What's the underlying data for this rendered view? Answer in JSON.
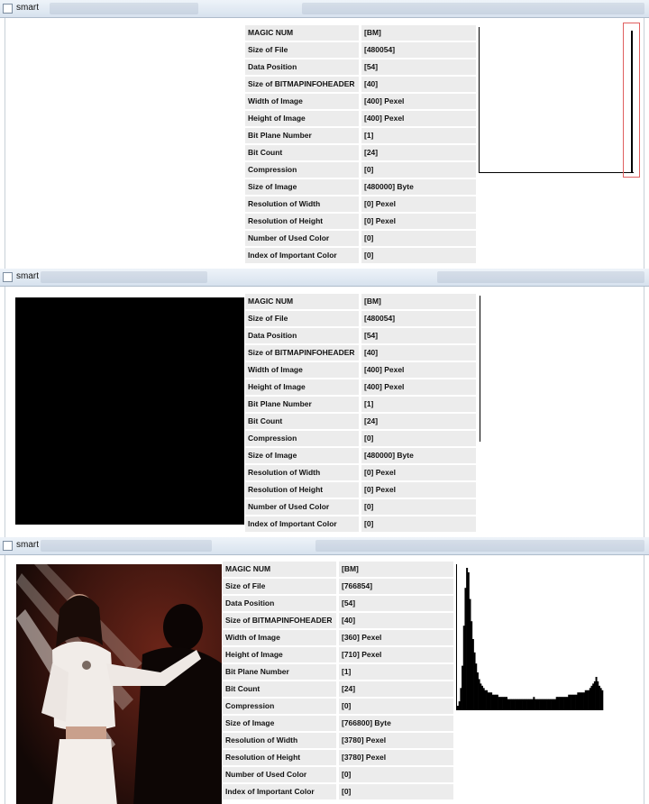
{
  "windows": [
    {
      "title": "smart",
      "info_rows": [
        {
          "label": "MAGIC NUM",
          "value": "[BM]"
        },
        {
          "label": "Size of File",
          "value": "[480054]"
        },
        {
          "label": "Data Position",
          "value": "[54]"
        },
        {
          "label": "Size of BITMAPINFOHEADER",
          "value": "[40]"
        },
        {
          "label": "Width of Image",
          "value": "[400] Pexel"
        },
        {
          "label": "Height of Image",
          "value": "[400] Pexel"
        },
        {
          "label": "Bit Plane Number",
          "value": "[1]"
        },
        {
          "label": "Bit Count",
          "value": "[24]"
        },
        {
          "label": "Compression",
          "value": "[0]"
        },
        {
          "label": "Size of Image",
          "value": "[480000] Byte"
        },
        {
          "label": "Resolution of Width",
          "value": "[0] Pexel"
        },
        {
          "label": "Resolution of Height",
          "value": "[0] Pexel"
        },
        {
          "label": "Number of Used Color",
          "value": "[0]"
        },
        {
          "label": "Index of Important Color",
          "value": "[0]"
        }
      ]
    },
    {
      "title": "smart",
      "info_rows": [
        {
          "label": "MAGIC NUM",
          "value": "[BM]"
        },
        {
          "label": "Size of File",
          "value": "[480054]"
        },
        {
          "label": "Data Position",
          "value": "[54]"
        },
        {
          "label": "Size of BITMAPINFOHEADER",
          "value": "[40]"
        },
        {
          "label": "Width of Image",
          "value": "[400] Pexel"
        },
        {
          "label": "Height of Image",
          "value": "[400] Pexel"
        },
        {
          "label": "Bit Plane Number",
          "value": "[1]"
        },
        {
          "label": "Bit Count",
          "value": "[24]"
        },
        {
          "label": "Compression",
          "value": "[0]"
        },
        {
          "label": "Size of Image",
          "value": "[480000] Byte"
        },
        {
          "label": "Resolution of Width",
          "value": "[0] Pexel"
        },
        {
          "label": "Resolution of Height",
          "value": "[0] Pexel"
        },
        {
          "label": "Number of Used Color",
          "value": "[0]"
        },
        {
          "label": "Index of Important Color",
          "value": "[0]"
        }
      ]
    },
    {
      "title": "smart",
      "info_rows": [
        {
          "label": "MAGIC NUM",
          "value": "[BM]"
        },
        {
          "label": "Size of File",
          "value": "[766854]"
        },
        {
          "label": "Data Position",
          "value": "[54]"
        },
        {
          "label": "Size of BITMAPINFOHEADER",
          "value": "[40]"
        },
        {
          "label": "Width of Image",
          "value": "[360] Pexel"
        },
        {
          "label": "Height of Image",
          "value": "[710] Pexel"
        },
        {
          "label": "Bit Plane Number",
          "value": "[1]"
        },
        {
          "label": "Bit Count",
          "value": "[24]"
        },
        {
          "label": "Compression",
          "value": "[0]"
        },
        {
          "label": "Size of Image",
          "value": "[766800] Byte"
        },
        {
          "label": "Resolution of Width",
          "value": "[3780] Pexel"
        },
        {
          "label": "Resolution of Height",
          "value": "[3780] Pexel"
        },
        {
          "label": "Number of Used Color",
          "value": "[0]"
        },
        {
          "label": "Index of Important Color",
          "value": "[0]"
        }
      ]
    }
  ],
  "histogram": {
    "bins": [
      2,
      4,
      10,
      20,
      38,
      55,
      64,
      62,
      50,
      40,
      32,
      26,
      21,
      17,
      14,
      12,
      11,
      10,
      9,
      9,
      8,
      8,
      8,
      7,
      7,
      7,
      7,
      6,
      6,
      6,
      6,
      6,
      6,
      5,
      5,
      5,
      5,
      5,
      5,
      5,
      5,
      5,
      5,
      5,
      5,
      5,
      5,
      5,
      5,
      5,
      6,
      5,
      5,
      5,
      5,
      5,
      5,
      5,
      5,
      5,
      5,
      5,
      5,
      5,
      5,
      6,
      6,
      6,
      6,
      6,
      6,
      6,
      6,
      7,
      7,
      7,
      7,
      7,
      7,
      8,
      8,
      8,
      8,
      8,
      9,
      9,
      9,
      10,
      11,
      12,
      13,
      15,
      13,
      11,
      10,
      9
    ]
  },
  "colors": {
    "row_bg": "#ececec",
    "titlebar": "#dbe5f0",
    "histogram_fill": "#000000",
    "selection_box": "#e06060"
  }
}
